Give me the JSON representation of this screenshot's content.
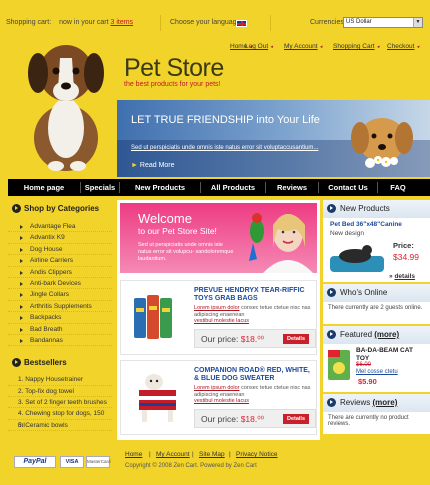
{
  "header": {
    "cart_label": "Shopping cart:",
    "cart_text": "now in your cart",
    "cart_items": "3 items",
    "language_label": "Choose your language:",
    "currency_label": "Currencies:",
    "currency_value": "US Dollar"
  },
  "top_links": [
    "Home",
    "Log Out",
    "My Account",
    "Shopping Cart",
    "Checkout"
  ],
  "logo": {
    "title": "Pet Store",
    "subtitle": "the best products for your pets!"
  },
  "banner": {
    "headline": "LET TRUE FRIENDSHIP into Your Life",
    "text": "Sed ut perspiciatis unde omnis iste natus error sit voluptaccusantium...",
    "more": "Read More"
  },
  "nav": [
    "Home page",
    "Specials",
    "New Products",
    "All Products",
    "Reviews",
    "Contact Us",
    "FAQ"
  ],
  "categories": {
    "title": "Shop by Categories",
    "items": [
      "Advantage Flea",
      "Advantix K9",
      "Dog House",
      "Airline Carriers",
      "Andis Clippers",
      "Anti-bark Devices",
      "Jingle Collars",
      "Arthritis Supplements",
      "Backpacks",
      "Bad Breath",
      "Bandannas"
    ]
  },
  "bestsellers": {
    "title": "Bestsellers",
    "items": [
      "1. Nappy Housetrainer",
      "2. Top-fix dog towel",
      "3. Set of 2 finger teeth brushes",
      "4. Chewing stop for dogs, 150 ml",
      "5. Ceramic bowls"
    ]
  },
  "welcome": {
    "line1": "Welcome",
    "line2": "to our Pet Store Site!",
    "text": "Sed ut perspiciatis unde omnis iste natus error sit volupcu- sandoloremque laudantium."
  },
  "products": [
    {
      "name": "PREVUE HENDRYX TEAR-RIFFIC TOYS GRAB BAGS",
      "desc_link": "Lorem ipsum dolor",
      "desc": "consec tetue ctetue nisc nas adipiscing enaenean",
      "desc_links2": "vestibul    molestie lacus",
      "price_label": "Our price:",
      "price": "$18.⁰⁰",
      "details": "Details"
    },
    {
      "name": "COMPANION ROAD® RED, WHITE, & BLUE DOG SWEATER",
      "desc_link": "Lorem ipsum dolor",
      "desc": "consec tetue ctetue nisc nas adipiscing enaenean",
      "desc_links2": "vestibul    molestie lacus",
      "price_label": "Our price:",
      "price": "$18.⁰⁰",
      "details": "Details"
    }
  ],
  "new_products": {
    "title": "New Products",
    "name": "Pet Bed 36\"x48\"Canine",
    "tag": "New design",
    "price_label": "Price:",
    "price": "$34.99",
    "details": "details"
  },
  "whos_online": {
    "title": "Who's Online",
    "text": "There currently are 2 guests online."
  },
  "featured": {
    "title": "Featured",
    "more": "(more)",
    "name": "BA-DA-BEAM CAT TOY",
    "old_price": "$6.00",
    "link": "Mel cosse ctetu",
    "price": "$5.90"
  },
  "reviews": {
    "title": "Reviews",
    "more": "(more)",
    "text": "There are currently no product reviews."
  },
  "footer": {
    "links": [
      "Home",
      "My Account",
      "Site Map",
      "Privacy Notice"
    ],
    "copyright": "Copyright © 2008 Zen Cart. Powered by Zen Cart",
    "paypal": "PayPal",
    "visa": "VISA",
    "mastercard": "MasterCard"
  }
}
